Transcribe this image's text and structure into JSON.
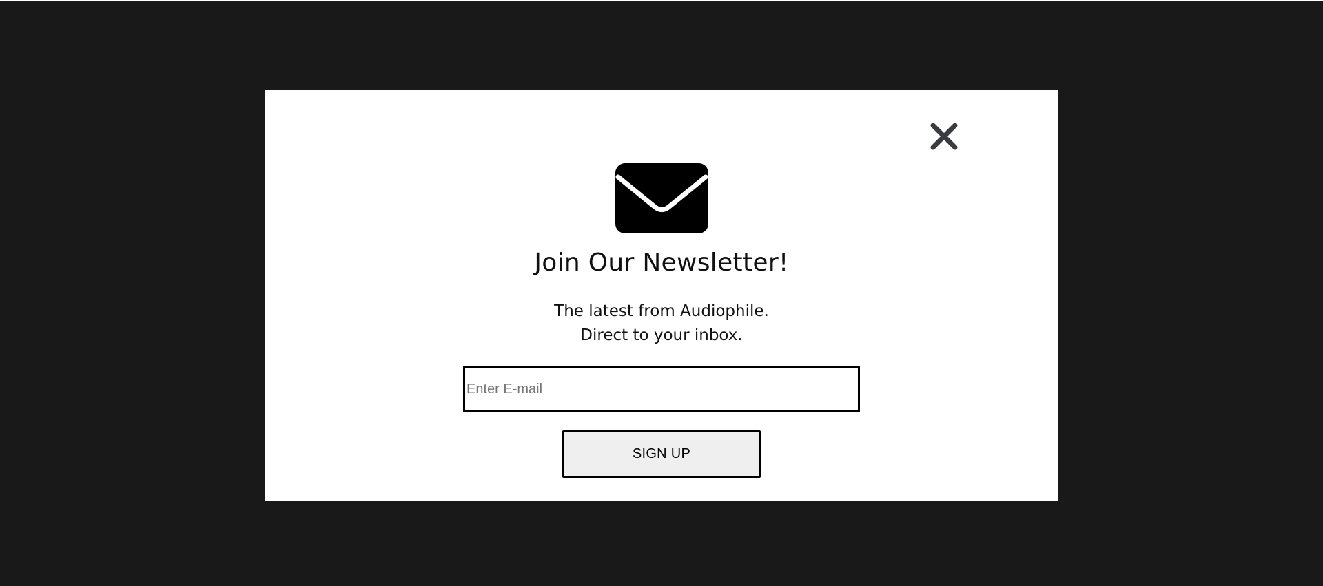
{
  "newsletter": {
    "title": "Join Our Newsletter!",
    "subtitle_line1": "The latest from Audiophile.",
    "subtitle_line2": "Direct to your inbox.",
    "email_placeholder": "Enter E-mail",
    "email_value": "",
    "signup_label": "SIGN UP"
  },
  "icons": {
    "close": "close-icon",
    "envelope": "envelope-icon"
  },
  "colors": {
    "backdrop": "#191919",
    "modal_background": "#ffffff",
    "close_icon": "#3a3b3f",
    "button_background": "#efefef",
    "text": "#111111"
  }
}
